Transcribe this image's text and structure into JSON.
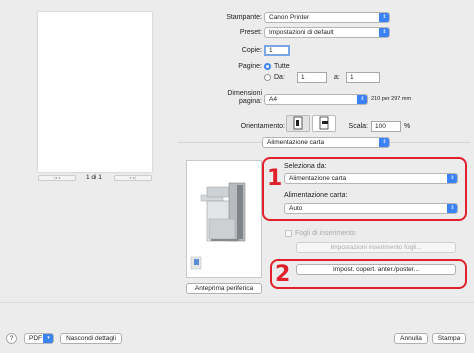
{
  "preview": {
    "page_label": "1 di 1",
    "nav_first": "|◂ ◂",
    "nav_last": "▸ ▸|"
  },
  "printer": {
    "label": "Stampante:",
    "value": "Canon Printer"
  },
  "preset": {
    "label": "Preset:",
    "value": "Impostazioni di default"
  },
  "copies": {
    "label": "Copie:",
    "value": "1"
  },
  "pages": {
    "label": "Pagine:",
    "all_label": "Tutte",
    "range_label": "Da:",
    "from": "1",
    "to_label": "a:",
    "to": "1"
  },
  "paper_size": {
    "label": "Dimensioni pagina:",
    "value": "A4",
    "dims": "210 per 297 mm"
  },
  "orientation": {
    "label": "Orientamento:"
  },
  "scale": {
    "label": "Scala:",
    "value": "100",
    "unit": "%"
  },
  "section": {
    "value": "Alimentazione carta"
  },
  "feed": {
    "select_from_label": "Seleziona da:",
    "select_from_value": "Alimentazione carta",
    "paper_feed_label": "Alimentazione carta:",
    "paper_feed_value": "Auto",
    "insert_sheets_label": "Fogli di inserimento",
    "insert_settings_button": "Impostazioni inserimento fogli...",
    "cover_button": "Impost. copert. anter./poster...",
    "device_preview_button": "Anteprima periferica"
  },
  "annotations": {
    "callout_1": "1",
    "callout_2": "2"
  },
  "footer": {
    "help": "?",
    "pdf": "PDF",
    "hide_details": "Nascondi dettagli",
    "cancel": "Annulla",
    "print": "Stampa"
  },
  "colors": {
    "accent": "#3b82f6",
    "callout": "#e0202a"
  }
}
